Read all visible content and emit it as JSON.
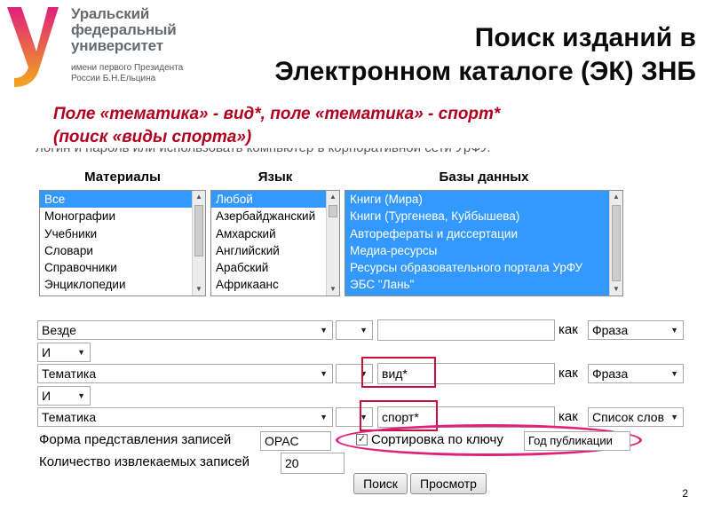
{
  "logo": {
    "line1": "Уральский",
    "line2": "федеральный",
    "line3": "университет",
    "small1": "имени первого Президента",
    "small2": "России Б.Н.Ельцина",
    "colors": {
      "top": "#e0207a",
      "bottom": "#f2a81d"
    }
  },
  "title": {
    "line1": "Поиск изданий в",
    "line2": "Электронном каталоге (ЭК) ЗНБ"
  },
  "subtitle": {
    "line1": "Поле «тематика» - вид*, поле «тематика» - спорт*",
    "line2": "(поиск «виды спорта»)"
  },
  "cut_text": "логин и пароль или использовать компьютер в корпоративной сети УрФУ.",
  "columns": {
    "materials": "Материалы",
    "language": "Язык",
    "databases": "Базы данных"
  },
  "materials": [
    "Все",
    "Монографии",
    "Учебники",
    "Словари",
    "Справочники",
    "Энциклопедии"
  ],
  "languages": [
    "Любой",
    "Азербайджанский",
    "Амхарский",
    "Английский",
    "Арабский",
    "Африкаанс"
  ],
  "databases": [
    "Книги (Мира)",
    "Книги (Тургенева, Куйбышева)",
    "Автореферaты и диссертации",
    "Медиа-ресурсы",
    "Ресурсы образовательного портала УрФУ",
    "ЭБС \"Лань\""
  ],
  "search_rows": [
    {
      "field": "Везде",
      "value": "",
      "kak": "как",
      "mode": "Фраза"
    },
    {
      "bool": "И",
      "field": "Тематика",
      "value": "вид*",
      "kak": "как",
      "mode": "Фраза"
    },
    {
      "bool": "И",
      "field": "Тематика",
      "value": "спорт*",
      "kak": "как",
      "mode": "Список слов"
    }
  ],
  "record_format": {
    "label": "Форма представления записей",
    "value": "OPAC"
  },
  "sort": {
    "label": "Сортировка по ключу",
    "checked": true,
    "value": "Год публикации"
  },
  "records_count": {
    "label": "Количество извлекаемых записей",
    "value": "20"
  },
  "buttons": {
    "search": "Поиск",
    "view": "Просмотр"
  },
  "page_number": "2"
}
